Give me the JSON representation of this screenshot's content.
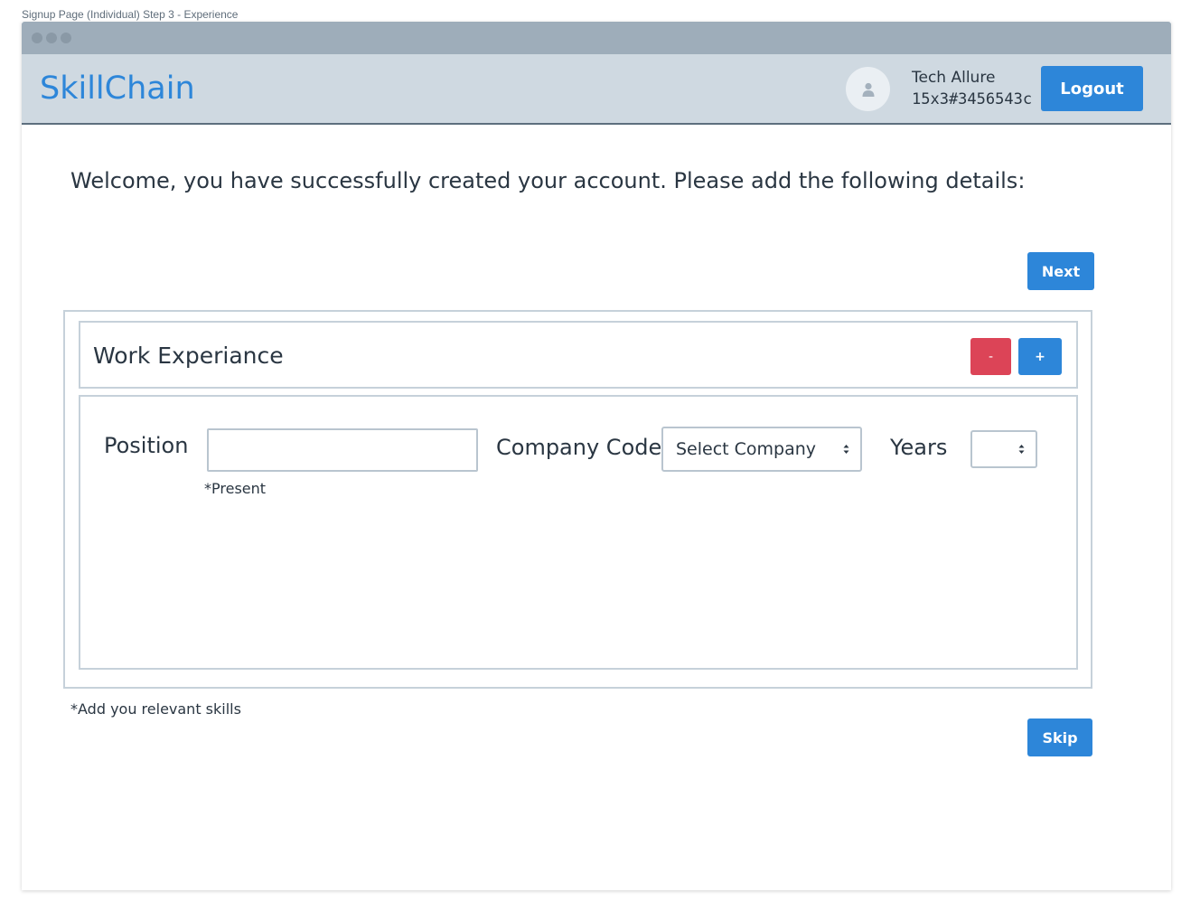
{
  "page_caption": "Signup Page (Individual) Step 3 - Experience",
  "navbar": {
    "brand": "SkillChain",
    "user_name": "Tech Allure",
    "user_id": "15x3#3456543c",
    "logout_label": "Logout",
    "avatar_icon": "user-icon"
  },
  "main": {
    "welcome_text": "Welcome, you have successfully created your account. Please add the following details:",
    "next_label": "Next",
    "section_title": "Work Experiance",
    "remove_label": "-",
    "add_label": "+",
    "position_label": "Position",
    "position_value": "",
    "present_note": "*Present",
    "company_code_label": "Company Code",
    "company_select_value": "Select Company",
    "years_label": "Years",
    "years_select_value": "",
    "skills_note": "*Add you relevant skills",
    "skip_label": "Skip"
  },
  "colors": {
    "accent": "#2d86d9",
    "danger": "#dc4457",
    "navbar_bg": "#cfd9e1",
    "titlebar_bg": "#9eadba"
  }
}
